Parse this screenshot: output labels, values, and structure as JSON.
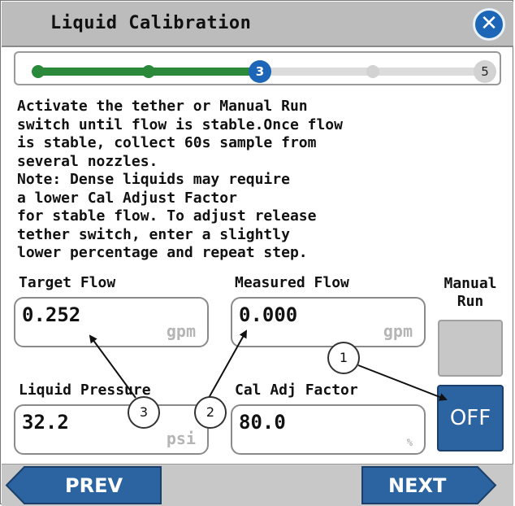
{
  "window": {
    "title": "Liquid Calibration",
    "close_icon": "close-icon"
  },
  "progress": {
    "current_step": "3",
    "total_steps": "5"
  },
  "instructions": "Activate the tether or Manual Run\nswitch until flow is stable.Once flow\nis stable, collect 60s sample from\nseveral nozzles.\nNote: Dense liquids may require\na lower Cal Adjust Factor\nfor stable flow. To adjust release\ntether switch, enter a slightly\nlower percentage and repeat step.",
  "fields": {
    "target_flow": {
      "label": "Target Flow",
      "value": "0.252",
      "unit": "gpm"
    },
    "measured_flow": {
      "label": "Measured Flow",
      "value": "0.000",
      "unit": "gpm"
    },
    "liquid_pressure": {
      "label": "Liquid Pressure",
      "value": "32.2",
      "unit": "psi"
    },
    "cal_adj_factor": {
      "label": "Cal Adj Factor",
      "value": "80.0",
      "unit": "%"
    }
  },
  "manual_run": {
    "label_line1": "Manual",
    "label_line2": "Run",
    "state": "OFF"
  },
  "footer": {
    "prev_label": "PREV",
    "next_label": "NEXT"
  },
  "callouts": [
    "1",
    "2",
    "3"
  ],
  "colors": {
    "accent_blue": "#1d66b7",
    "progress_green": "#2a8a3a",
    "nav_blue": "#2b64a0"
  }
}
